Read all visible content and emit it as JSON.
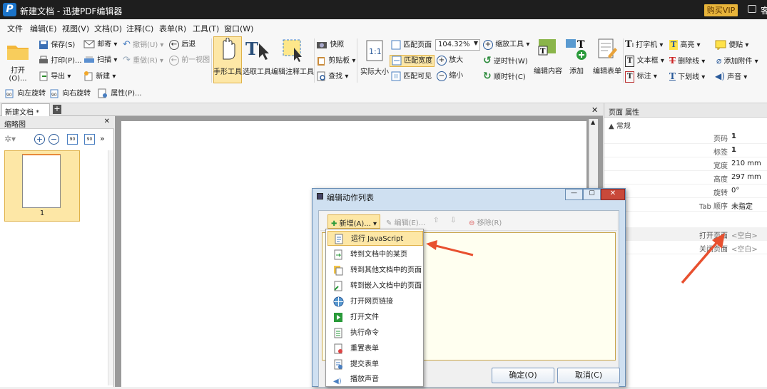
{
  "app": {
    "title": "新建文档 - 迅捷PDF编辑器",
    "logo_text": "P",
    "vip": "购买VIP",
    "more": "客"
  },
  "menu": [
    "文件",
    "编辑(E)",
    "视图(V)",
    "文档(D)",
    "注释(C)",
    "表单(R)",
    "工具(T)",
    "窗口(W)"
  ],
  "ribbon": {
    "open": "打开(O)...",
    "save": "保存(S)",
    "print": "打印(P)...",
    "export": "导出",
    "mail": "邮寄",
    "scan": "扫描",
    "new": "新建",
    "undo": "撤销(U)",
    "redo": "重做(R)",
    "back": "后退",
    "prev_view": "前一视图",
    "hand": "手形工具",
    "select": "选取工具",
    "edit_annot": "编辑注释工具",
    "snapshot": "快照",
    "clipboard": "剪贴板",
    "find": "查找",
    "actual": "实际大小",
    "fit_page": "匹配页面",
    "fit_width": "匹配宽度",
    "fit_visible": "匹配可见",
    "zoom_value": "104.32%",
    "zoom_tool": "缩放工具",
    "zoom_in": "放大",
    "zoom_out": "缩小",
    "ccw": "逆时针(W)",
    "cw": "顺时针(C)",
    "edit_content": "编辑内容",
    "add": "添加",
    "edit_form": "编辑表单",
    "typewriter": "打字机",
    "textbox": "文本框",
    "callout": "标注",
    "highlight": "高亮",
    "strike": "删除线",
    "underline": "下划线",
    "note": "便贴",
    "attach": "添加附件",
    "sound": "声音",
    "rot_left": "向左旋转",
    "rot_right": "向右旋转",
    "props": "属性(P)..."
  },
  "tabs": {
    "doc": "新建文档 *"
  },
  "thumbs": {
    "title": "缩略图",
    "page_label": "1"
  },
  "props": {
    "title": "页面 属性",
    "group": "常规",
    "rows": [
      {
        "k": "页码",
        "v": "1"
      },
      {
        "k": "标签",
        "v": "1"
      },
      {
        "k": "宽度",
        "v": "210 mm"
      },
      {
        "k": "高度",
        "v": "297 mm"
      },
      {
        "k": "旋转",
        "v": "0°"
      },
      {
        "k": "Tab 顺序",
        "v": "未指定"
      }
    ],
    "open_page": {
      "k": "打开页面",
      "v": "<空白>"
    },
    "close_page": {
      "k": "关闭页面",
      "v": "<空白>"
    }
  },
  "dialog": {
    "title": "编辑动作列表",
    "new": "新增(A)...",
    "edit": "编辑(E)...",
    "remove": "移除(R)",
    "ok": "确定(O)",
    "cancel": "取消(C)",
    "items": [
      "运行 JavaScript",
      "转到文档中的某页",
      "转到其他文档中的页面",
      "转到嵌入文档中的页面",
      "打开网页链接",
      "打开文件",
      "执行命令",
      "重置表单",
      "提交表单",
      "播放声音"
    ]
  },
  "colors": {
    "accent": "#fde7a6",
    "arrow": "#e8502f",
    "vip": "#e8b43a"
  }
}
